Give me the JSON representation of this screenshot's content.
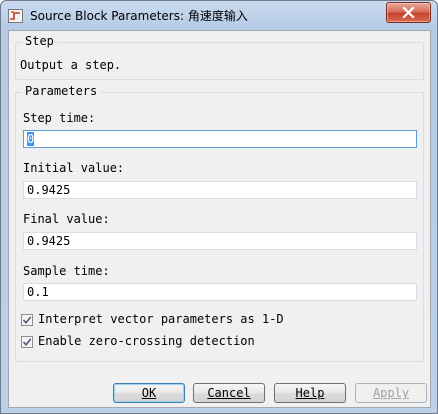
{
  "window": {
    "title": "Source Block Parameters: 角速度输入",
    "icon": "simulink-block-icon",
    "close_icon": "close-icon"
  },
  "step_group": {
    "legend": "Step",
    "description": "Output a step."
  },
  "params_group": {
    "legend": "Parameters",
    "fields": [
      {
        "label": "Step time:",
        "value": "0"
      },
      {
        "label": "Initial value:",
        "value": "0.9425"
      },
      {
        "label": "Final value:",
        "value": "0.9425"
      },
      {
        "label": "Sample time:",
        "value": "0.1"
      }
    ],
    "checkboxes": [
      {
        "label": "Interpret vector parameters as 1-D",
        "checked": true
      },
      {
        "label": "Enable zero-crossing detection",
        "checked": true
      }
    ]
  },
  "buttons": {
    "ok": "OK",
    "cancel": "Cancel",
    "help": "Help",
    "apply": "Apply"
  },
  "colors": {
    "frame": "#bcd0e8",
    "close": "#c4432b",
    "checkmark": "#4a5a7a",
    "selection": "#3399ff"
  }
}
